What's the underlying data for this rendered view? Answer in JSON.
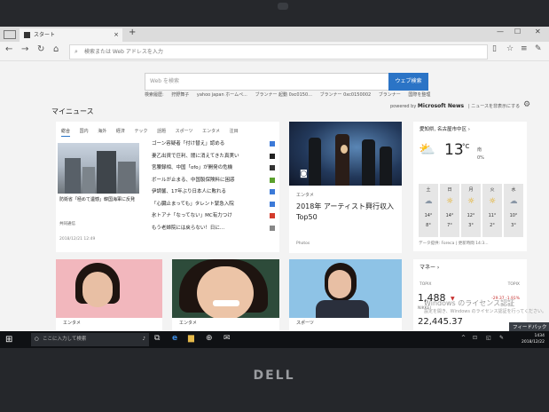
{
  "browser": {
    "tab_title": "スタート",
    "tab_close": "×",
    "new_tab": "+",
    "window_minimize": "—",
    "window_maximize": "☐",
    "window_close": "✕",
    "back": "←",
    "forward": "→",
    "refresh": "↻",
    "home": "⌂",
    "address_placeholder": "検索または Web アドレスを入力",
    "toolbar_icons": [
      "▯",
      "☆",
      "≡",
      "✎",
      "⇪",
      "…"
    ]
  },
  "search": {
    "placeholder": "Web を検索",
    "button": "ウェブ検索",
    "trending_label": "検索履歴:",
    "trending": [
      "狩野舞子",
      "yahoo japan ホームペ...",
      "ブランナー 起動 0xc0150...",
      "ブランナー 0xc0150002",
      "ブランナー",
      "国際を整理"
    ]
  },
  "news": {
    "section_title": "マイニュース",
    "powered_prefix": "powered by",
    "powered_brand": "Microsoft News",
    "customize": "| ニュースを非表示にする",
    "categories": [
      "総合",
      "国内",
      "海外",
      "経済",
      "テック",
      "話題",
      "スポーツ",
      "エンタメ",
      "注目"
    ],
    "lead": {
      "headline": "防衛省「極めて遺憾」韓国海軍に反発",
      "source": "共同通信",
      "time": "2018/12/21 12:49"
    },
    "headlines": [
      {
        "text": "ゴーン容疑者「付け替え」認める",
        "color": "#3c7ad8"
      },
      {
        "text": "妻乙出資で巨利、闇に消えてきた真実い",
        "color": "#222222"
      },
      {
        "text": "宮腰録相、中国「ofo」が開発の危機",
        "color": "#333333"
      },
      {
        "text": "ボールが止まる、中国製保険料に困惑",
        "color": "#5aa02c"
      },
      {
        "text": "伊調馨、17年ぶり日本人に敗れる",
        "color": "#3c7ad8"
      },
      {
        "text": "「心臓止まっても」タレント緊急入院",
        "color": "#3c7ad8"
      },
      {
        "text": "氷トアナ「なってない」MC有力つけ",
        "color": "#d33b2c"
      },
      {
        "text": "もう老婦院には戻らない！日に...",
        "color": "#888888"
      }
    ],
    "feature": {
      "category": "エンタメ",
      "title": "2018年 アーティスト興行収入Top50",
      "source": "Photos"
    },
    "tiles": [
      {
        "category": "エンタメ"
      },
      {
        "category": "エンタメ"
      },
      {
        "category": "スポーツ"
      }
    ]
  },
  "weather": {
    "location": "愛知県, 名古屋市中区 ›",
    "temp": "13",
    "unit": "°C",
    "wind": "南",
    "precip": "0%",
    "condition_icon": "partly-cloudy-icon",
    "forecast": [
      {
        "day": "土",
        "icon": "☁",
        "hi": "14°",
        "lo": "8°"
      },
      {
        "day": "日",
        "icon": "☼",
        "hi": "14°",
        "lo": "7°"
      },
      {
        "day": "月",
        "icon": "☼",
        "hi": "12°",
        "lo": "3°"
      },
      {
        "day": "火",
        "icon": "☼",
        "hi": "11°",
        "lo": "2°"
      },
      {
        "day": "水",
        "icon": "☁",
        "hi": "10°",
        "lo": "3°"
      }
    ],
    "data_source": "データ提供: Foreca | 更新時間 14:3..."
  },
  "market": {
    "title": "マネー ›",
    "right_label": "",
    "index_name": "TOPIX",
    "index_name_right": "TOPIX",
    "value": "1,488",
    "arrow": "▼",
    "change": "-29.37 -1.91%",
    "sub": "NIKKEI",
    "value2": "22,445.37"
  },
  "overlay": {
    "watermark": "Windows のライセンス認証",
    "watermark_sub": "設定を開き、Windows のライセンス認証を行ってください。",
    "feedback": "フィードバック"
  },
  "taskbar": {
    "start": "⊞",
    "search_placeholder": "ここに入力して検索",
    "time": "1434",
    "date": "2018/12/22",
    "apps": [
      "⧉",
      "e",
      "▆",
      "⊕",
      "✉"
    ],
    "tray": [
      "^",
      "⊡",
      "◱",
      "✎"
    ]
  },
  "hardware": {
    "brand": "DELL"
  },
  "colors": {
    "accent": "#2b74c6",
    "taskbar": "#0f1114",
    "down": "#c7312f"
  }
}
